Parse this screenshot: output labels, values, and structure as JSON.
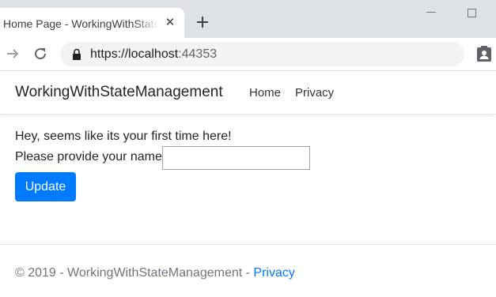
{
  "browser": {
    "tab_title": "Home Page - WorkingWithStateManagement",
    "url_host": "https://localhost",
    "url_port": ":44353"
  },
  "navbar": {
    "brand": "WorkingWithStateManagement",
    "links": [
      "Home",
      "Privacy"
    ]
  },
  "main": {
    "greeting": "Hey, seems like its your first time here!",
    "name_label": "Please provide your name:",
    "name_value": "",
    "update_label": "Update"
  },
  "footer": {
    "text": "© 2019 - WorkingWithStateManagement - ",
    "link": "Privacy"
  },
  "colors": {
    "primary": "#007bff",
    "tabstrip": "#dee1e6",
    "omnibox": "#f1f3f4",
    "footer_text": "#6c757d"
  },
  "icons": [
    "close-icon",
    "plus-icon",
    "minimize-icon",
    "maximize-icon",
    "forward-arrow-icon",
    "reload-icon",
    "lock-icon",
    "profile-icon"
  ]
}
